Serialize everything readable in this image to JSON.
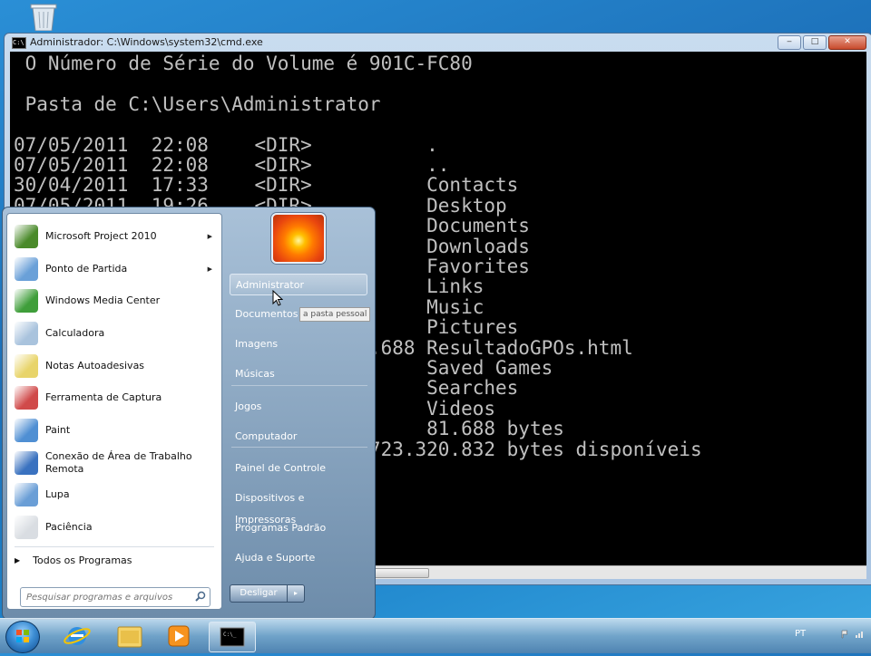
{
  "desktop": {
    "icons": [
      "recycle-bin-icon"
    ]
  },
  "console_window": {
    "title": "Administrador: C:\\Windows\\system32\\cmd.exe",
    "buttons": {
      "minimize": "‒",
      "maximize": "□",
      "close": "✕"
    },
    "lines": [
      " O Número de Série do Volume é 901C-FC80",
      "",
      " Pasta de C:\\Users\\Administrator",
      "",
      "07/05/2011  22:08    <DIR>          .",
      "07/05/2011  22:08    <DIR>          ..",
      "30/04/2011  17:33    <DIR>          Contacts",
      "07/05/2011  19:26    <DIR>          Desktop",
      "                                    Documents",
      "                                    Downloads",
      "                                    Favorites",
      "                                    Links",
      "                                    Music",
      "                                    Pictures",
      "                              1.688 ResultadoGPOs.html",
      "                                    Saved Games",
      "                                    Searches",
      "                                    Videos",
      "                                    81.688 bytes",
      "                              .723.320.832 bytes disponíveis"
    ],
    "scrollbar_grip": "|||"
  },
  "start_menu": {
    "programs": [
      {
        "label": "Microsoft Project 2010",
        "icon": "microsoft-project-icon",
        "submenu": true
      },
      {
        "label": "Ponto de Partida",
        "icon": "getting-started-icon",
        "submenu": true
      },
      {
        "label": "Windows Media Center",
        "icon": "media-center-icon",
        "submenu": false
      },
      {
        "label": "Calculadora",
        "icon": "calculator-icon",
        "submenu": false
      },
      {
        "label": "Notas Autoadesivas",
        "icon": "sticky-notes-icon",
        "submenu": false
      },
      {
        "label": "Ferramenta de Captura",
        "icon": "snipping-tool-icon",
        "submenu": false
      },
      {
        "label": "Paint",
        "icon": "paint-icon",
        "submenu": false
      },
      {
        "label": "Conexão de Área de Trabalho\nRemota",
        "icon": "remote-desktop-icon",
        "submenu": false
      },
      {
        "label": "Lupa",
        "icon": "magnifier-icon",
        "submenu": false
      },
      {
        "label": "Paciência",
        "icon": "solitaire-icon",
        "submenu": false
      }
    ],
    "all_programs": "Todos os Programas",
    "search_placeholder": "Pesquisar programas e arquivos",
    "right_items": [
      "Administrator",
      "Documentos",
      "Imagens",
      "Músicas",
      "Jogos",
      "Computador",
      "Painel de Controle",
      "Dispositivos e Impressoras",
      "Programas Padrão",
      "Ajuda e Suporte"
    ],
    "tooltip": "a pasta pessoal",
    "shutdown_label": "Desligar",
    "shutdown_arrow": "▸"
  },
  "taskbar": {
    "pinned": [
      "internet-explorer-icon",
      "windows-explorer-icon",
      "media-player-icon",
      "command-prompt-icon"
    ],
    "language": "PT"
  }
}
